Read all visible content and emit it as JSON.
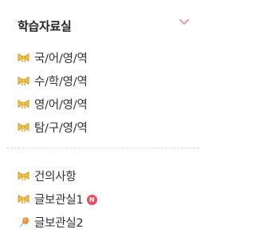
{
  "section": {
    "title": "학습자료실"
  },
  "primary_items": [
    {
      "label": "국/어/영/역",
      "icon": "ribbon-bow-icon"
    },
    {
      "label": "수/학/영/역",
      "icon": "ribbon-bow-icon"
    },
    {
      "label": "영/어/영/역",
      "icon": "ribbon-bow-icon"
    },
    {
      "label": "탐/구/영/역",
      "icon": "ribbon-bow-icon"
    }
  ],
  "secondary_items": [
    {
      "label": "건의사항",
      "icon": "ribbon-bow-icon"
    },
    {
      "label": "글보관실1",
      "icon": "ribbon-bow-icon",
      "badge": "N"
    },
    {
      "label": "글보관실2",
      "icon": "balloon-icon"
    }
  ],
  "colors": {
    "chevron": "#e39aa9",
    "bow_fill": "#f3c33b",
    "badge": "#e8505b"
  }
}
